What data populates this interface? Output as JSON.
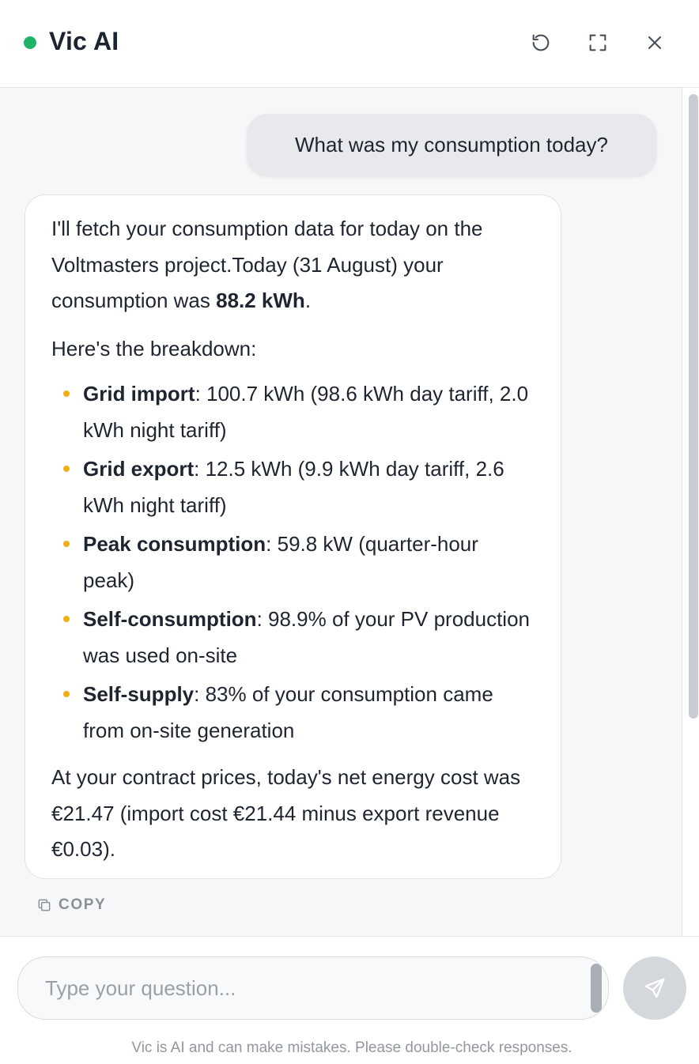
{
  "header": {
    "title": "Vic AI",
    "status_color": "#1fb36a",
    "icons": [
      "refresh-icon",
      "expand-icon",
      "close-icon"
    ]
  },
  "chat": {
    "user_message": "What was my consumption today?",
    "bot": {
      "intro_pre": "I'll fetch your consumption data for today on the Voltmasters project.Today (31 August) your consumption was ",
      "intro_bold": "88.2 kWh",
      "intro_post": ".",
      "breakdown_heading": "Here's the breakdown:",
      "bullets": [
        {
          "label": "Grid import",
          "text": ": 100.7 kWh (98.6 kWh day tariff, 2.0 kWh night tariff)"
        },
        {
          "label": "Grid export",
          "text": ": 12.5 kWh (9.9 kWh day tariff, 2.6 kWh night tariff)"
        },
        {
          "label": "Peak consumption",
          "text": ": 59.8 kW (quarter-hour peak)"
        },
        {
          "label": "Self-consumption",
          "text": ": 98.9% of your PV production was used on-site"
        },
        {
          "label": "Self-supply",
          "text": ": 83% of your consumption came from on-site generation"
        }
      ],
      "closing": "At your contract prices, today's net energy cost was €21.47 (import cost €21.44 minus export revenue €0.03)."
    },
    "copy_label": "COPY",
    "bullet_color": "#f4ad17"
  },
  "composer": {
    "placeholder": "Type your question...",
    "value": "",
    "disclaimer": "Vic is AI and can make mistakes. Please double-check responses."
  }
}
